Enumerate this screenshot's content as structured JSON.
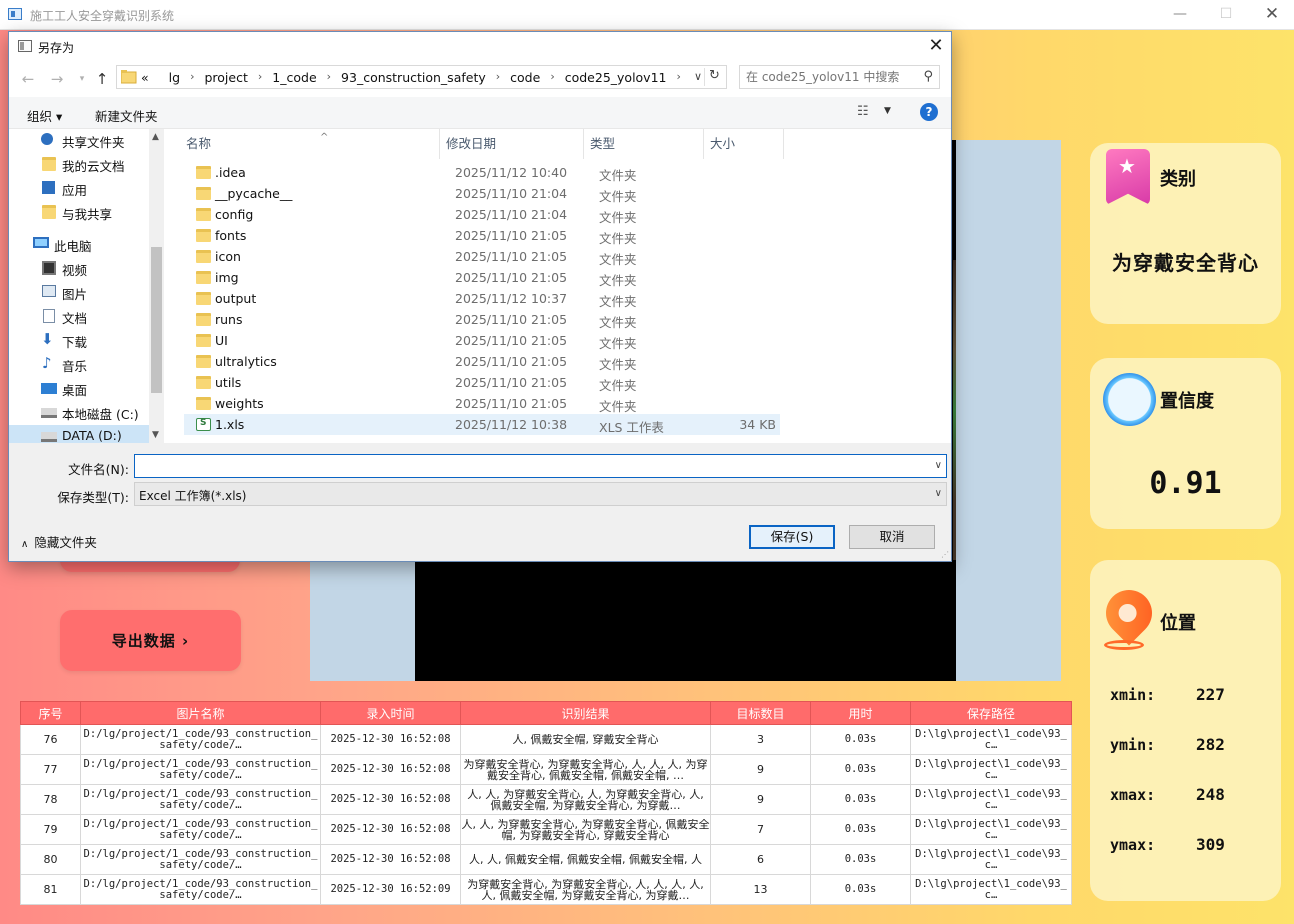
{
  "app": {
    "title": "施工工人安全穿戴识别系统",
    "min_glyph": "—",
    "max_glyph": "☐",
    "close_glyph": "✕"
  },
  "left_panel": {
    "export_button": "导出数据 ›"
  },
  "cards": {
    "category": {
      "title": "类别",
      "value": "为穿戴安全背心"
    },
    "confidence": {
      "title": "置信度",
      "value": "0.91"
    },
    "position": {
      "title": "位置",
      "xmin_label": "xmin:",
      "xmin": "227",
      "ymin_label": "ymin:",
      "ymin": "282",
      "xmax_label": "xmax:",
      "xmax": "248",
      "ymax_label": "ymax:",
      "ymax": "309"
    }
  },
  "table": {
    "headers": [
      "序号",
      "图片名称",
      "录入时间",
      "识别结果",
      "目标数目",
      "用时",
      "保存路径"
    ],
    "rows": [
      [
        "76",
        "D:/lg/project/1_code/93_construction_safety/code/…",
        "2025-12-30 16:52:08",
        "人, 佩戴安全帽, 穿戴安全背心",
        "3",
        "0.03s",
        "D:\\lg\\project\\1_code\\93_c…"
      ],
      [
        "77",
        "D:/lg/project/1_code/93_construction_safety/code/…",
        "2025-12-30 16:52:08",
        "为穿戴安全背心, 为穿戴安全背心, 人, 人, 人, 为穿戴安全背心, 佩戴安全帽, 佩戴安全帽, …",
        "9",
        "0.03s",
        "D:\\lg\\project\\1_code\\93_c…"
      ],
      [
        "78",
        "D:/lg/project/1_code/93_construction_safety/code/…",
        "2025-12-30 16:52:08",
        "人, 人, 为穿戴安全背心, 人, 为穿戴安全背心, 人, 佩戴安全帽, 为穿戴安全背心, 为穿戴…",
        "9",
        "0.03s",
        "D:\\lg\\project\\1_code\\93_c…"
      ],
      [
        "79",
        "D:/lg/project/1_code/93_construction_safety/code/…",
        "2025-12-30 16:52:08",
        "人, 人, 为穿戴安全背心, 为穿戴安全背心, 佩戴安全帽, 为穿戴安全背心, 穿戴安全背心",
        "7",
        "0.03s",
        "D:\\lg\\project\\1_code\\93_c…"
      ],
      [
        "80",
        "D:/lg/project/1_code/93_construction_safety/code/…",
        "2025-12-30 16:52:08",
        "人, 人, 佩戴安全帽, 佩戴安全帽, 佩戴安全帽, 人",
        "6",
        "0.03s",
        "D:\\lg\\project\\1_code\\93_c…"
      ],
      [
        "81",
        "D:/lg/project/1_code/93_construction_safety/code/…",
        "2025-12-30 16:52:09",
        "为穿戴安全背心, 为穿戴安全背心, 人, 人, 人, 人, 人, 佩戴安全帽, 为穿戴安全背心, 为穿戴…",
        "13",
        "0.03s",
        "D:\\lg\\project\\1_code\\93_c…"
      ]
    ]
  },
  "dialog": {
    "title": "另存为",
    "close_glyph": "✕",
    "nav": {
      "back": "←",
      "forward": "→",
      "recent": "▾",
      "up": "↑"
    },
    "breadcrumb": [
      "«",
      "lg",
      "project",
      "1_code",
      "93_construction_safety",
      "code",
      "code25_yolov11"
    ],
    "breadcrumb_sep": "›",
    "search_placeholder": "在 code25_yolov11 中搜索",
    "commands": {
      "organize": "组织 ▾",
      "new_folder": "新建文件夹",
      "help": "?"
    },
    "nav_items": [
      {
        "label": "共享文件夹",
        "icon": "share-icon"
      },
      {
        "label": "我的云文档",
        "icon": "folder-icon"
      },
      {
        "label": "应用",
        "icon": "apps-icon"
      },
      {
        "label": "与我共享",
        "icon": "folder-icon"
      },
      {
        "label": "此电脑",
        "icon": "computer-icon"
      },
      {
        "label": "视频",
        "icon": "video-icon"
      },
      {
        "label": "图片",
        "icon": "pictures-icon"
      },
      {
        "label": "文档",
        "icon": "documents-icon"
      },
      {
        "label": "下载",
        "icon": "download-icon"
      },
      {
        "label": "音乐",
        "icon": "music-icon"
      },
      {
        "label": "桌面",
        "icon": "desktop-icon"
      },
      {
        "label": "本地磁盘 (C:)",
        "icon": "drive-icon"
      },
      {
        "label": "DATA (D:)",
        "icon": "drive-icon"
      }
    ],
    "columns": [
      "名称",
      "修改日期",
      "类型",
      "大小"
    ],
    "files": [
      {
        "name": ".idea",
        "date": "2025/11/12 10:40",
        "type": "文件夹",
        "size": ""
      },
      {
        "name": "__pycache__",
        "date": "2025/11/10 21:04",
        "type": "文件夹",
        "size": ""
      },
      {
        "name": "config",
        "date": "2025/11/10 21:04",
        "type": "文件夹",
        "size": ""
      },
      {
        "name": "fonts",
        "date": "2025/11/10 21:05",
        "type": "文件夹",
        "size": ""
      },
      {
        "name": "icon",
        "date": "2025/11/10 21:05",
        "type": "文件夹",
        "size": ""
      },
      {
        "name": "img",
        "date": "2025/11/10 21:05",
        "type": "文件夹",
        "size": ""
      },
      {
        "name": "output",
        "date": "2025/11/12 10:37",
        "type": "文件夹",
        "size": ""
      },
      {
        "name": "runs",
        "date": "2025/11/10 21:05",
        "type": "文件夹",
        "size": ""
      },
      {
        "name": "UI",
        "date": "2025/11/10 21:05",
        "type": "文件夹",
        "size": ""
      },
      {
        "name": "ultralytics",
        "date": "2025/11/10 21:05",
        "type": "文件夹",
        "size": ""
      },
      {
        "name": "utils",
        "date": "2025/11/10 21:05",
        "type": "文件夹",
        "size": ""
      },
      {
        "name": "weights",
        "date": "2025/11/10 21:05",
        "type": "文件夹",
        "size": ""
      },
      {
        "name": "1.xls",
        "date": "2025/11/12 10:38",
        "type": "XLS 工作表",
        "size": "34 KB"
      }
    ],
    "filename_label": "文件名(N):",
    "filename_value": "",
    "filetype_label": "保存类型(T):",
    "filetype_value": "Excel 工作簿(*.xls)",
    "hide_folders": "隐藏文件夹",
    "save_button": "保存(S)",
    "cancel_button": "取消"
  }
}
